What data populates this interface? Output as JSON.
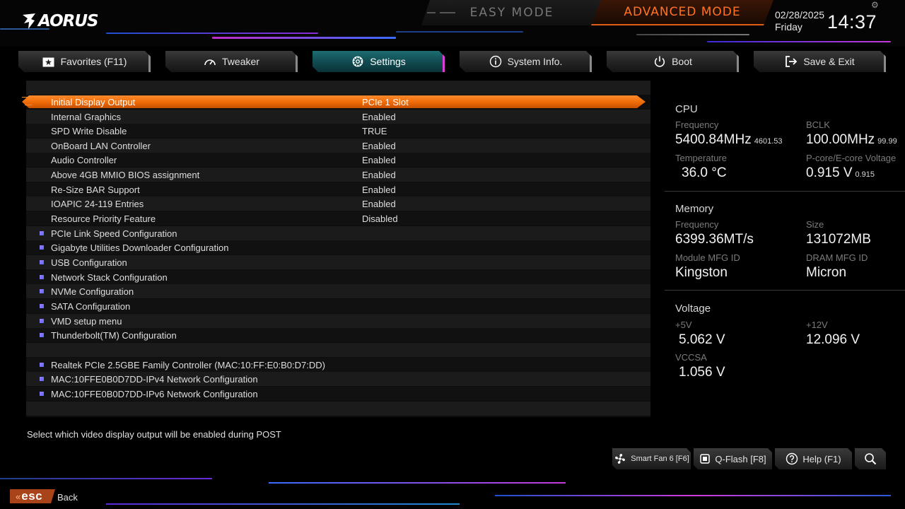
{
  "header": {
    "brand": "AORUS",
    "easy_mode": "EASY MODE",
    "advanced_mode": "ADVANCED MODE",
    "date": "02/28/2025",
    "day": "Friday",
    "time": "14:37",
    "accent_color": "#ff7420"
  },
  "tabs": [
    {
      "label": "Favorites (F11)",
      "icon": "star-folder-icon"
    },
    {
      "label": "Tweaker",
      "icon": "speedometer-icon"
    },
    {
      "label": "Settings",
      "icon": "gear-icon",
      "active": true
    },
    {
      "label": "System Info.",
      "icon": "info-icon"
    },
    {
      "label": "Boot",
      "icon": "power-icon"
    },
    {
      "label": "Save & Exit",
      "icon": "exit-icon"
    }
  ],
  "settings": [
    {
      "label": "Initial Display Output",
      "value": "PCIe 1 Slot",
      "selected": true
    },
    {
      "label": "Internal Graphics",
      "value": "Enabled"
    },
    {
      "label": "SPD Write Disable",
      "value": "TRUE"
    },
    {
      "label": "OnBoard LAN Controller",
      "value": "Enabled"
    },
    {
      "label": "Audio Controller",
      "value": "Enabled"
    },
    {
      "label": "Above 4GB MMIO BIOS assignment",
      "value": "Enabled"
    },
    {
      "label": "Re-Size BAR Support",
      "value": "Enabled"
    },
    {
      "label": "IOAPIC 24-119 Entries",
      "value": "Enabled"
    },
    {
      "label": "Resource Priority Feature",
      "value": "Disabled"
    },
    {
      "label": "PCIe Link Speed Configuration",
      "submenu": true
    },
    {
      "label": "Gigabyte Utilities Downloader Configuration",
      "submenu": true
    },
    {
      "label": "USB Configuration",
      "submenu": true
    },
    {
      "label": "Network Stack Configuration",
      "submenu": true
    },
    {
      "label": "NVMe Configuration",
      "submenu": true
    },
    {
      "label": "SATA Configuration",
      "submenu": true
    },
    {
      "label": "VMD setup menu",
      "submenu": true
    },
    {
      "label": "Thunderbolt(TM) Configuration",
      "submenu": true
    },
    {
      "label": "",
      "blank": true
    },
    {
      "label": "Realtek PCIe 2.5GBE Family Controller (MAC:10:FF:E0:B0:D7:DD)",
      "submenu": true
    },
    {
      "label": "MAC:10FFE0B0D7DD-IPv4 Network Configuration",
      "submenu": true
    },
    {
      "label": "MAC:10FFE0B0D7DD-IPv6 Network Configuration",
      "submenu": true
    }
  ],
  "help_text": "Select which video display output will be enabled during POST",
  "info": {
    "cpu": {
      "title": "CPU",
      "frequency_label": "Frequency",
      "frequency_value": "5400.84MHz",
      "frequency_sub": "4601.53",
      "bclk_label": "BCLK",
      "bclk_value": "100.00MHz",
      "bclk_sub": "99.99",
      "temperature_label": "Temperature",
      "temperature_value": "36.0 °C",
      "voltage_label": "P-core/E-core Voltage",
      "voltage_value": "0.915 V",
      "voltage_sub": "0.915"
    },
    "memory": {
      "title": "Memory",
      "frequency_label": "Frequency",
      "frequency_value": "6399.36MT/s",
      "size_label": "Size",
      "size_value": "131072MB",
      "module_label": "Module MFG ID",
      "module_value": "Kingston",
      "dram_label": "DRAM MFG ID",
      "dram_value": "Micron"
    },
    "voltage": {
      "title": "Voltage",
      "v5_label": "+5V",
      "v5_value": "5.062 V",
      "v12_label": "+12V",
      "v12_value": "12.096 V",
      "vccsa_label": "VCCSA",
      "vccsa_value": "1.056 V"
    }
  },
  "bottom_buttons": [
    {
      "label": "Smart Fan 6 [F6]",
      "icon": "fan-icon"
    },
    {
      "label": "Q-Flash [F8]",
      "icon": "chip-icon"
    },
    {
      "label": "Help (F1)",
      "icon": "help-icon"
    },
    {
      "label": "",
      "icon": "search-icon"
    }
  ],
  "footer": {
    "esc": "esc",
    "back": "Back"
  }
}
